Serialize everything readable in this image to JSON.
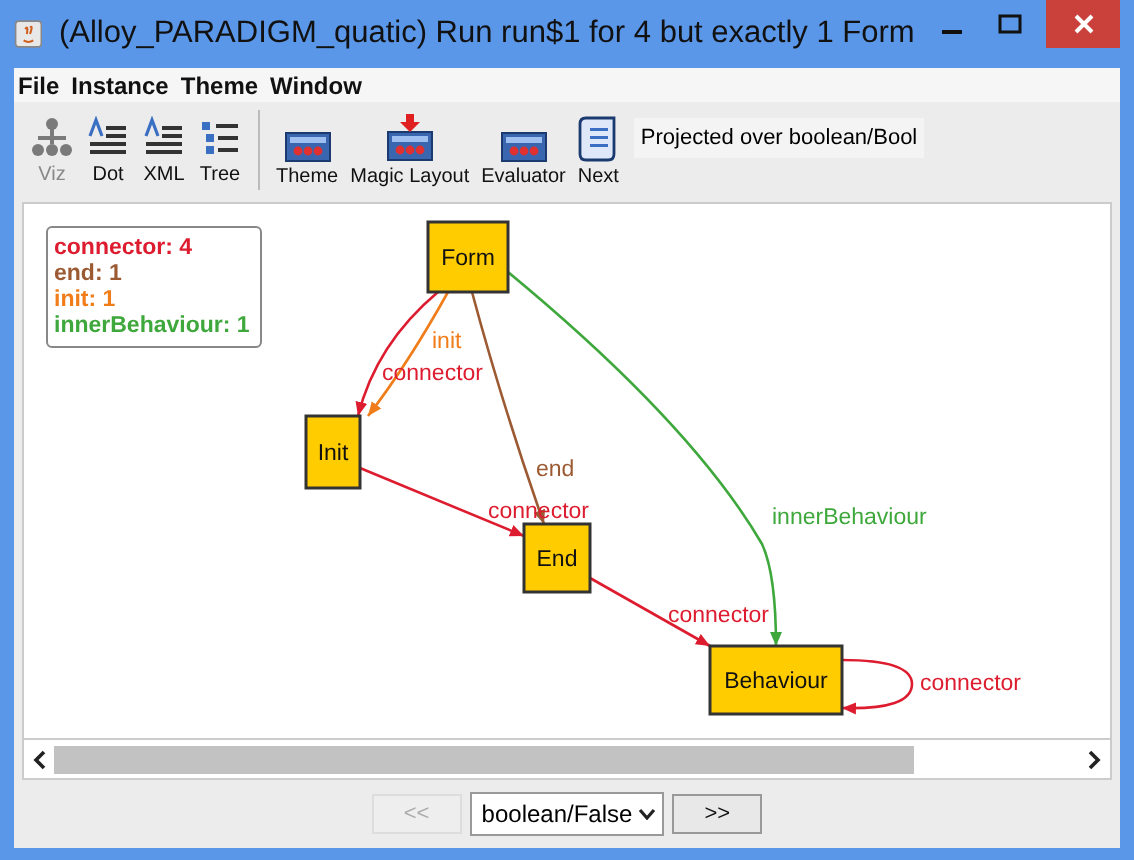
{
  "window": {
    "title": "(Alloy_PARADIGM_quatic) Run run$1 for 4 but exactly 1 Form"
  },
  "menu": [
    "File",
    "Instance",
    "Theme",
    "Window"
  ],
  "toolbar": [
    {
      "label": "Viz",
      "kind": "tree",
      "disabled": true
    },
    {
      "label": "Dot",
      "kind": "doc",
      "disabled": false
    },
    {
      "label": "XML",
      "kind": "doc",
      "disabled": false
    },
    {
      "label": "Tree",
      "kind": "list",
      "disabled": false
    },
    {
      "label": "Theme",
      "kind": "panel",
      "disabled": false
    },
    {
      "label": "Magic Layout",
      "kind": "magic",
      "disabled": false
    },
    {
      "label": "Evaluator",
      "kind": "panel",
      "disabled": false
    },
    {
      "label": "Next",
      "kind": "scroll",
      "disabled": false
    }
  ],
  "projection": "Projected over boolean/Bool",
  "legend": [
    {
      "text": "connector: 4",
      "color": "#dd1d2f"
    },
    {
      "text": "end: 1",
      "color": "#9c5a33"
    },
    {
      "text": "init: 1",
      "color": "#f07d1a"
    },
    {
      "text": "innerBehaviour: 1",
      "color": "#3ea83c"
    }
  ],
  "graph": {
    "nodes": [
      {
        "label": "Form"
      },
      {
        "label": "Init"
      },
      {
        "label": "End"
      },
      {
        "label": "Behaviour"
      }
    ],
    "edges": [
      {
        "label": "init",
        "color": "#f07d1a"
      },
      {
        "label": "connector",
        "color": "#dd1d2f"
      },
      {
        "label": "end",
        "color": "#9c5a33"
      },
      {
        "label": "connector",
        "color": "#dd1d2f"
      },
      {
        "label": "innerBehaviour",
        "color": "#3ea83c"
      },
      {
        "label": "connector",
        "color": "#dd1d2f"
      },
      {
        "label": "connector",
        "color": "#dd1d2f"
      }
    ]
  },
  "bottom": {
    "prev": {
      "label": "<<",
      "disabled": true
    },
    "select": "boolean/False",
    "next": {
      "label": ">>",
      "disabled": false
    }
  }
}
